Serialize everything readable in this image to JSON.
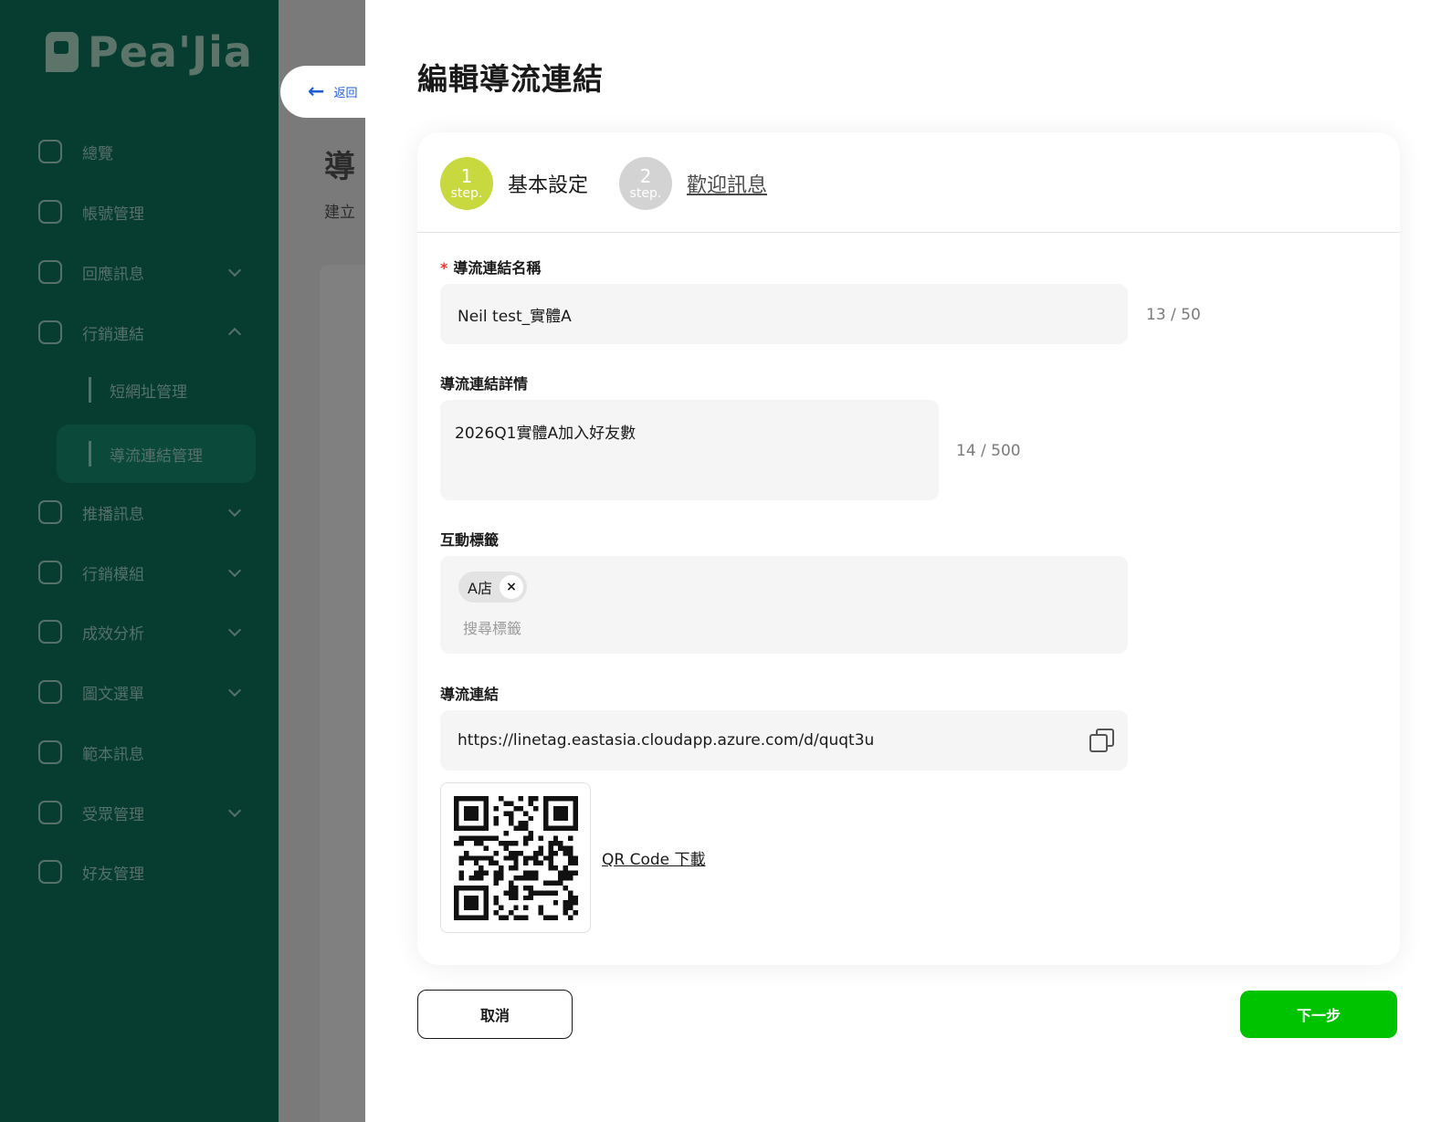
{
  "sidebar": {
    "logo_text": "Pea'Jia",
    "items": [
      {
        "label": "總覽"
      },
      {
        "label": "帳號管理"
      },
      {
        "label": "回應訊息"
      },
      {
        "label": "行銷連結"
      },
      {
        "label": "推播訊息"
      },
      {
        "label": "行銷模組"
      },
      {
        "label": "成效分析"
      },
      {
        "label": "圖文選單"
      },
      {
        "label": "範本訊息"
      },
      {
        "label": "受眾管理"
      },
      {
        "label": "好友管理"
      }
    ],
    "sub_items": [
      {
        "label": "短網址管理"
      },
      {
        "label": "導流連結管理",
        "active": true
      }
    ]
  },
  "background_page": {
    "title": "導",
    "subtitle": "建立",
    "back_label": "返回"
  },
  "drawer": {
    "title": "編輯導流連結",
    "steps": [
      {
        "num": "1",
        "step_word": "step.",
        "label": "基本設定",
        "state": "active"
      },
      {
        "num": "2",
        "step_word": "step.",
        "label": "歡迎訊息",
        "state": "inactive"
      }
    ],
    "name_field": {
      "required_mark": "*",
      "label": "導流連結名稱",
      "value": "Neil test_實體A",
      "counter": "13 / 50"
    },
    "detail_field": {
      "label": "導流連結詳情",
      "value": "2026Q1實體A加入好友數",
      "counter": "14 / 500"
    },
    "tags_field": {
      "label": "互動標籤",
      "tags": [
        "A店"
      ],
      "remove_glyph": "×",
      "search_placeholder": "搜尋標籤"
    },
    "link_field": {
      "label": "導流連結",
      "value": "https://linetag.eastasia.cloudapp.azure.com/d/quqt3u"
    },
    "qr_download_label": "QR Code 下載",
    "cancel_label": "取消",
    "next_label": "下一步"
  },
  "colors": {
    "sidebar_bg": "#073c30",
    "step_active": "#c7d93f",
    "step_inactive": "#d3d3d3",
    "primary_button": "#00c300",
    "link_blue": "#1d5ed8",
    "required": "#e53935"
  }
}
